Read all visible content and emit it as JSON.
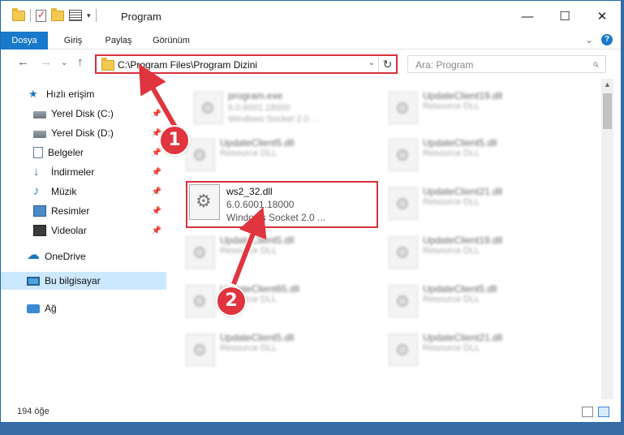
{
  "window": {
    "title": "Program",
    "controls": {
      "minimize": "—",
      "maximize": "☐",
      "close": "✕"
    }
  },
  "ribbon": {
    "tabs": [
      "Dosya",
      "Giriş",
      "Paylaş",
      "Görünüm"
    ]
  },
  "nav": {
    "address": "C:\\Program Files\\Program Dizini",
    "search_placeholder": "Ara: Program"
  },
  "sidebar": {
    "items": [
      {
        "label": "Hızlı erişim",
        "icon": "star-icon"
      },
      {
        "label": "Yerel Disk (C:)",
        "icon": "disk-icon"
      },
      {
        "label": "Yerel Disk (D:)",
        "icon": "disk-icon"
      },
      {
        "label": "Belgeler",
        "icon": "documents-icon"
      },
      {
        "label": "İndirmeler",
        "icon": "download-icon"
      },
      {
        "label": "Müzik",
        "icon": "music-icon"
      },
      {
        "label": "Resimler",
        "icon": "pictures-icon"
      },
      {
        "label": "Videolar",
        "icon": "videos-icon"
      },
      {
        "label": "OneDrive",
        "icon": "onedrive-icon"
      },
      {
        "label": "Bu bilgisayar",
        "icon": "this-pc-icon"
      },
      {
        "label": "Ağ",
        "icon": "network-icon"
      }
    ]
  },
  "files": {
    "left": [
      {
        "name": "program.exe",
        "line1": "6.0.6001.18000",
        "line2": "Windows Socket 2.0 ..."
      },
      {
        "name": "UpdateClient5.dll",
        "line1": "Resource DLL"
      },
      {
        "name": "UpdateClient5.dll",
        "line1": "Resource DLL"
      },
      {
        "name": "UpdateClient65.dll",
        "line1": "Resource DLL"
      },
      {
        "name": "UpdateClient5.dll",
        "line1": "Resource DLL"
      }
    ],
    "right": [
      {
        "name": "UpdateClient19.dll",
        "line1": "Resource DLL"
      },
      {
        "name": "UpdateClient5.dll",
        "line1": "Resource DLL"
      },
      {
        "name": "UpdateClient21.dll",
        "line1": "Resource DLL"
      },
      {
        "name": "UpdateClient19.dll",
        "line1": "Resource DLL"
      },
      {
        "name": "UpdateClient5.dll",
        "line1": "Resource DLL"
      },
      {
        "name": "UpdateClient21.dll",
        "line1": "Resource DLL"
      }
    ],
    "highlighted": {
      "name": "ws2_32.dll",
      "line1": "6.0.6001.18000",
      "line2": "Windows Socket 2.0 ..."
    }
  },
  "status": {
    "count": "194 öğe"
  },
  "callouts": {
    "one": "1",
    "two": "2"
  },
  "colors": {
    "accent": "#1979ca",
    "callout": "#e0343e",
    "highlight_border": "#d9303c"
  }
}
